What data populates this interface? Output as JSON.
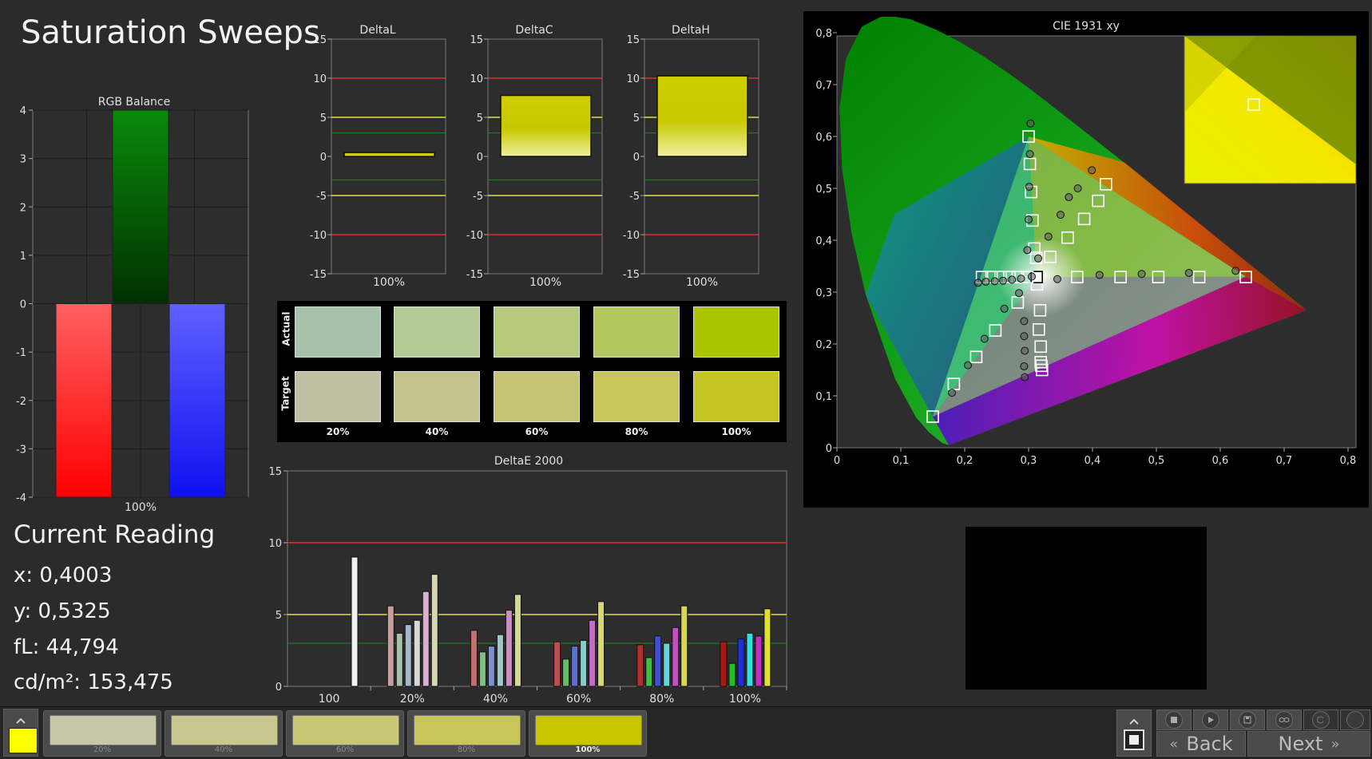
{
  "page": {
    "title": "Saturation Sweeps"
  },
  "rgb_balance": {
    "title": "RGB Balance",
    "x_label": "100%",
    "y_ticks": [
      "4",
      "3",
      "2",
      "1",
      "0",
      "-1",
      "-2",
      "-3",
      "-4"
    ]
  },
  "delta_charts": {
    "y_ticks": [
      "15",
      "10",
      "5",
      "0",
      "-5",
      "-10",
      "-15"
    ],
    "deltaL": {
      "title": "DeltaL",
      "x_label": "100%"
    },
    "deltaC": {
      "title": "DeltaC",
      "x_label": "100%"
    },
    "deltaH": {
      "title": "DeltaH",
      "x_label": "100%"
    }
  },
  "swatch_grid": {
    "row_actual": "Actual",
    "row_target": "Target",
    "labels": [
      "20%",
      "40%",
      "60%",
      "80%",
      "100%"
    ],
    "actual_colors": [
      "#a8c3ac",
      "#b4ca97",
      "#b7cb7d",
      "#b3c75e",
      "#adc500"
    ],
    "target_colors": [
      "#bfbfa1",
      "#c4c38d",
      "#c6c576",
      "#c6c65c",
      "#c5c625"
    ]
  },
  "deltae_chart": {
    "title": "DeltaE 2000",
    "y_ticks": [
      "15",
      "10",
      "5",
      "0"
    ],
    "x_labels": [
      "100",
      "20%",
      "40%",
      "60%",
      "80%",
      "100%"
    ]
  },
  "cie": {
    "title": "CIE 1931 xy",
    "x_ticks": [
      "0",
      "0,1",
      "0,2",
      "0,3",
      "0,4",
      "0,5",
      "0,6",
      "0,7",
      "0,8"
    ],
    "y_ticks": [
      "0",
      "0,1",
      "0,2",
      "0,3",
      "0,4",
      "0,5",
      "0,6",
      "0,7",
      "0,8"
    ]
  },
  "current_reading": {
    "title": "Current Reading",
    "x": "x: 0,4003",
    "y": "y: 0,5325",
    "fl": "fL: 44,794",
    "cdm2": "cd/m²: 153,475"
  },
  "bottom": {
    "current_color": "#ffff00",
    "patches": [
      {
        "label": "20%",
        "color": "#c7c7a8"
      },
      {
        "label": "40%",
        "color": "#c8c790"
      },
      {
        "label": "60%",
        "color": "#c7c776"
      },
      {
        "label": "80%",
        "color": "#c8c55a"
      },
      {
        "label": "100%",
        "color": "#c9c600"
      }
    ],
    "back_label": "Back",
    "next_label": "Next"
  },
  "chart_data": [
    {
      "type": "bar",
      "title": "RGB Balance",
      "categories": [
        "100%"
      ],
      "series": [
        {
          "name": "Red",
          "values": [
            -4.0
          ]
        },
        {
          "name": "Green",
          "values": [
            4.0
          ]
        },
        {
          "name": "Blue",
          "values": [
            -4.0
          ]
        }
      ],
      "ylim": [
        -4,
        4
      ]
    },
    {
      "type": "bar",
      "title": "DeltaL",
      "categories": [
        "100%"
      ],
      "values": [
        0.5
      ],
      "ylim": [
        -15,
        15
      ],
      "reference_lines": {
        "red": [
          10,
          -10
        ],
        "yellow": [
          5,
          -5
        ],
        "green": [
          3,
          -3
        ]
      }
    },
    {
      "type": "bar",
      "title": "DeltaC",
      "categories": [
        "100%"
      ],
      "values": [
        7.8
      ],
      "ylim": [
        -15,
        15
      ],
      "reference_lines": {
        "red": [
          10,
          -10
        ],
        "yellow": [
          5,
          -5
        ],
        "green": [
          3,
          -3
        ]
      }
    },
    {
      "type": "bar",
      "title": "DeltaH",
      "categories": [
        "100%"
      ],
      "values": [
        10.3
      ],
      "ylim": [
        -15,
        15
      ],
      "reference_lines": {
        "red": [
          10,
          -10
        ],
        "yellow": [
          5,
          -5
        ],
        "green": [
          3,
          -3
        ]
      }
    },
    {
      "type": "bar",
      "title": "DeltaE 2000",
      "categories": [
        "100",
        "20%",
        "40%",
        "60%",
        "80%",
        "100%"
      ],
      "groups": [
        {
          "label": "100",
          "values": [
            9.0
          ],
          "colors": [
            "#f0f0f0"
          ]
        },
        {
          "label": "20%",
          "values": [
            5.6,
            3.7,
            4.3,
            4.6,
            6.6,
            7.8
          ],
          "colors": [
            "#c6a0a0",
            "#a8c0a8",
            "#a8b8c8",
            "#d8d8d8",
            "#d8b0d0",
            "#d8d8b0"
          ]
        },
        {
          "label": "40%",
          "values": [
            3.9,
            2.4,
            2.8,
            3.6,
            5.3,
            6.4
          ],
          "colors": [
            "#c07070",
            "#80c080",
            "#8090c8",
            "#a0c8c8",
            "#c890c0",
            "#d8d890"
          ]
        },
        {
          "label": "60%",
          "values": [
            3.1,
            1.9,
            2.8,
            3.2,
            4.6,
            5.9
          ],
          "colors": [
            "#b85050",
            "#60c060",
            "#6070c8",
            "#80d0d0",
            "#c070c0",
            "#d8d870"
          ]
        },
        {
          "label": "80%",
          "values": [
            2.9,
            2.0,
            3.5,
            3.0,
            4.1,
            5.6
          ],
          "colors": [
            "#b03030",
            "#40c040",
            "#4050d0",
            "#60d8d8",
            "#c050c0",
            "#d8d850"
          ]
        },
        {
          "label": "100%",
          "values": [
            3.1,
            1.6,
            3.3,
            3.7,
            3.5,
            5.4
          ],
          "colors": [
            "#a81818",
            "#20c020",
            "#2030d8",
            "#30e0e0",
            "#c030c0",
            "#e0e030"
          ]
        }
      ],
      "ylim": [
        0,
        15
      ],
      "reference_lines": {
        "red": 10,
        "yellow": 5,
        "green": 3
      }
    },
    {
      "type": "scatter",
      "title": "CIE 1931 xy",
      "xlim": [
        0,
        0.8
      ],
      "ylim": [
        0,
        0.8
      ],
      "series": [
        {
          "marker": "square",
          "x": [
            0.15,
            0.183,
            0.218,
            0.248,
            0.283,
            0.3,
            0.302,
            0.304,
            0.306,
            0.309,
            0.312,
            0.313,
            0.318,
            0.316,
            0.319,
            0.319,
            0.32,
            0.321,
            0.3127,
            0.227,
            0.242,
            0.256,
            0.27,
            0.283,
            0.298,
            0.334,
            0.361,
            0.387,
            0.409,
            0.421,
            0.376,
            0.444,
            0.503,
            0.567,
            0.64
          ],
          "y": [
            0.06,
            0.123,
            0.175,
            0.226,
            0.28,
            0.6,
            0.547,
            0.493,
            0.438,
            0.384,
            0.366,
            0.315,
            0.265,
            0.228,
            0.195,
            0.165,
            0.158,
            0.15,
            0.329,
            0.329,
            0.329,
            0.329,
            0.329,
            0.329,
            0.329,
            0.368,
            0.405,
            0.441,
            0.476,
            0.508,
            0.329,
            0.329,
            0.329,
            0.329,
            0.329
          ]
        },
        {
          "marker": "circle",
          "x": [
            0.18,
            0.205,
            0.231,
            0.262,
            0.285,
            0.298,
            0.3,
            0.301,
            0.302,
            0.303,
            0.305,
            0.293,
            0.293,
            0.294,
            0.293,
            0.294,
            0.221,
            0.233,
            0.247,
            0.26,
            0.274,
            0.288,
            0.315,
            0.331,
            0.35,
            0.363,
            0.377,
            0.399,
            0.345,
            0.411,
            0.477,
            0.551,
            0.624
          ],
          "y": [
            0.106,
            0.159,
            0.21,
            0.268,
            0.298,
            0.381,
            0.44,
            0.503,
            0.566,
            0.625,
            0.33,
            0.244,
            0.215,
            0.187,
            0.157,
            0.136,
            0.318,
            0.32,
            0.321,
            0.322,
            0.324,
            0.326,
            0.365,
            0.407,
            0.449,
            0.483,
            0.5,
            0.535,
            0.325,
            0.333,
            0.335,
            0.337,
            0.341
          ]
        }
      ],
      "current_point": {
        "x": 0.4003,
        "y": 0.5325
      }
    }
  ]
}
